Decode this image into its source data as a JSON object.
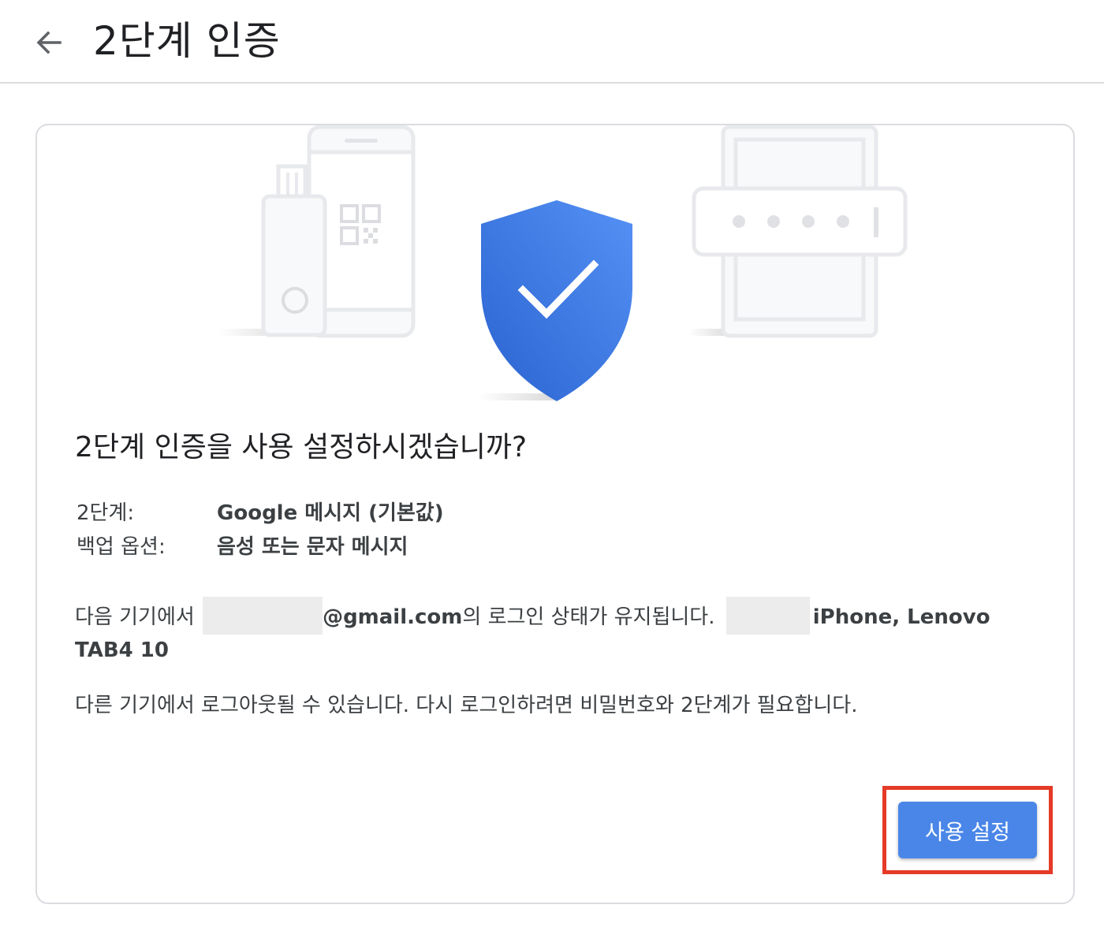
{
  "header": {
    "back_icon": "arrow-back-icon",
    "title": "2단계 인증"
  },
  "illustration": {
    "icons": [
      "security-key-icon",
      "phone-qr-icon",
      "shield-check-icon",
      "tablet-password-icon"
    ],
    "colors": {
      "shield_top": "#5591f5",
      "shield_bottom": "#2a63d0",
      "device_outline": "#e8e9ec",
      "device_fill": "#f8f9fa"
    }
  },
  "content": {
    "question": "2단계 인증을 사용 설정하시겠습니까?",
    "rows": [
      {
        "label": "2단계:",
        "value": "Google 메시지 (기본값)"
      },
      {
        "label": "백업 옵션:",
        "value": "음성 또는 문자 메시지"
      }
    ],
    "devices_text": {
      "prefix": "다음 기기에서",
      "email_suffix": "@gmail.com",
      "middle": "의 로그인 상태가 유지됩니다.",
      "devices_part1": "iPhone, Lenovo",
      "devices_part2": "TAB4 10"
    },
    "notice": "다른 기기에서 로그아웃될 수 있습니다. 다시 로그인하려면 비밀번호와 2단계가 필요합니다."
  },
  "actions": {
    "enable_label": "사용 설정",
    "button_color": "#4a86e8",
    "highlight_color": "#e53a27"
  }
}
